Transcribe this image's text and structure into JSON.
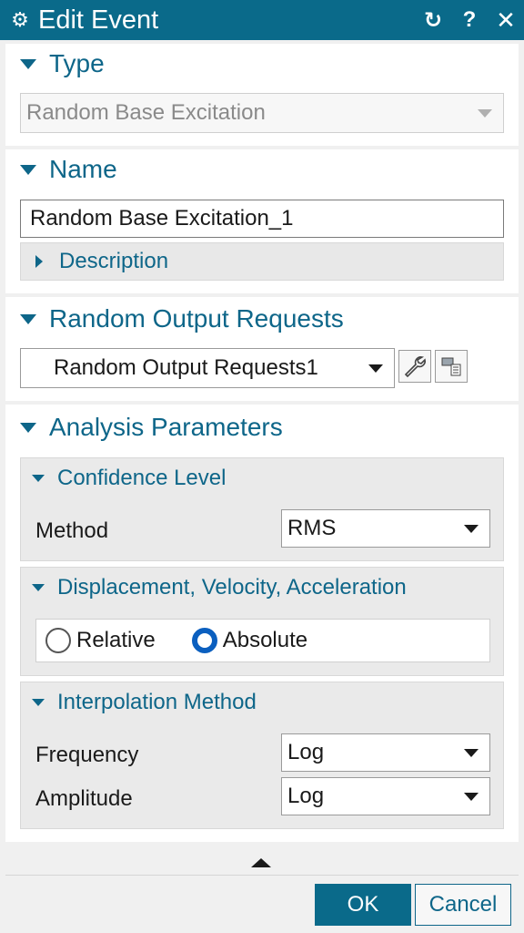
{
  "window": {
    "title": "Edit Event",
    "icons": {
      "app": "gear-icon",
      "reset": "reset-icon",
      "help": "help-icon",
      "close": "close-icon"
    },
    "help_glyph": "?",
    "close_glyph": "✕",
    "reset_glyph": "↻",
    "app_glyph": "⚙"
  },
  "type_group": {
    "header": "Type",
    "select_value": "Random Base Excitation"
  },
  "name_group": {
    "header": "Name",
    "name_value": "Random Base Excitation_1",
    "description_label": "Description"
  },
  "output_group": {
    "header": "Random Output Requests",
    "select_value": "Random Output Requests1",
    "edit_icon": "wrench-icon",
    "manager_icon": "manager-icon"
  },
  "analysis_group": {
    "header": "Analysis Parameters",
    "confidence": {
      "header": "Confidence Level",
      "method_label": "Method",
      "method_value": "RMS"
    },
    "dva": {
      "header": "Displacement, Velocity, Acceleration",
      "options": [
        "Relative",
        "Absolute"
      ],
      "selected": "Absolute"
    },
    "interpolation": {
      "header": "Interpolation Method",
      "frequency_label": "Frequency",
      "frequency_value": "Log",
      "amplitude_label": "Amplitude",
      "amplitude_value": "Log"
    }
  },
  "footer": {
    "ok_label": "OK",
    "cancel_label": "Cancel"
  },
  "colors": {
    "titlebar": "#0a6a8a",
    "accent_text": "#0e6689",
    "radio_selected": "#0b5fbf"
  }
}
